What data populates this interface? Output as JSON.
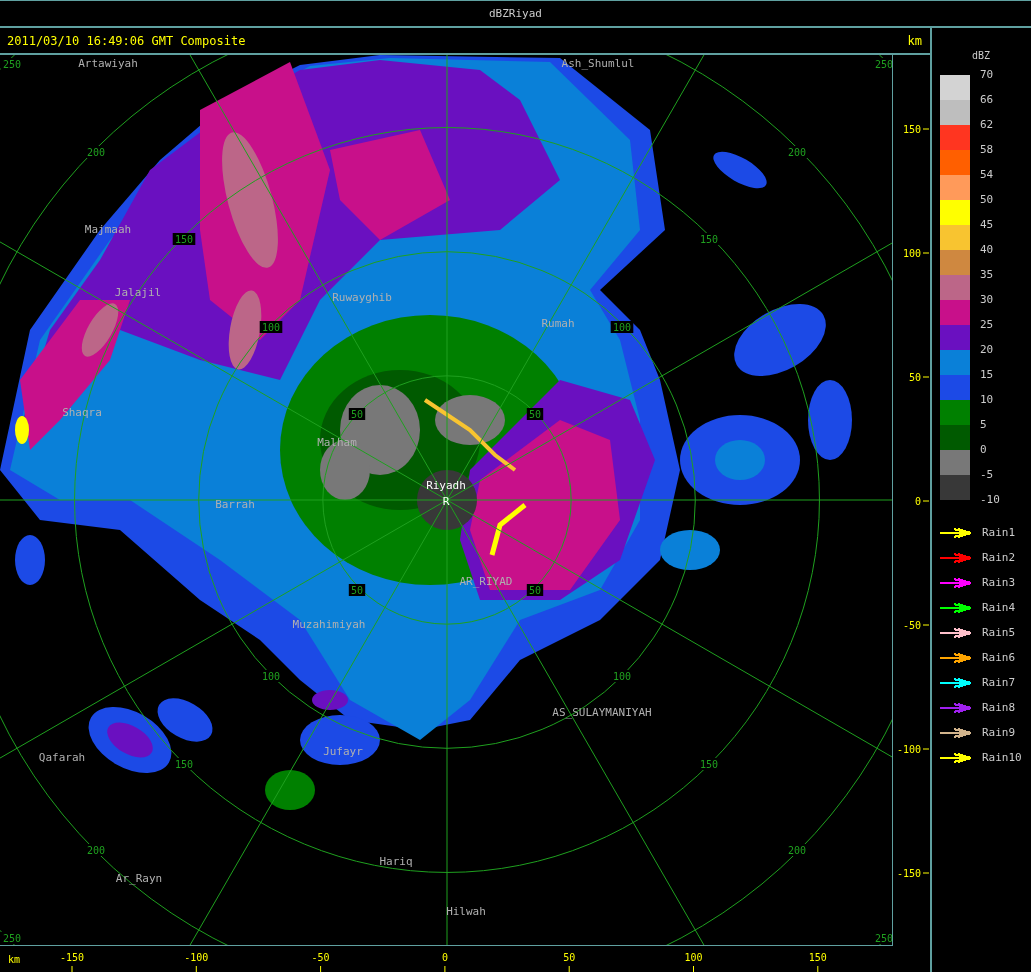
{
  "window": {
    "title": "dBZRiyad"
  },
  "header": {
    "timestamp": "2011/03/10 16:49:06 GMT Composite",
    "unit": "km"
  },
  "map": {
    "range_labels": [
      "250",
      "250",
      "250",
      "250",
      "200",
      "200",
      "200",
      "200",
      "150",
      "150",
      "150",
      "150",
      "100",
      "100",
      "100",
      "100",
      "50",
      "50",
      "50",
      "50"
    ],
    "place_labels": [
      "Artawiyah",
      "Ash_Shumlul",
      "Majmaah",
      "Jalajil",
      "Shaqra",
      "Ruwayghib",
      "Rumah",
      "Malham",
      "Riyadh",
      "R",
      "Barrah",
      "AR_RIYAD",
      "Muzahimiyah",
      "AS_SULAYMANIYAH",
      "Jufayr",
      "Qafarah",
      "Hariq",
      "Ar_Rayn",
      "Hilwah"
    ]
  },
  "y_axis": {
    "ticks": [
      "150",
      "100",
      "50",
      "0",
      "-50",
      "-100",
      "-150"
    ]
  },
  "x_axis": {
    "unit": "km",
    "ticks": [
      "-150",
      "-100",
      "-50",
      "0",
      "50",
      "100",
      "150"
    ]
  },
  "legend": {
    "title": "dBZ",
    "swatches": [
      {
        "color": "#d3d3d3"
      },
      {
        "color": "#bebebe"
      },
      {
        "color": "#ff3520"
      },
      {
        "color": "#ff5f00"
      },
      {
        "color": "#ff9a5a"
      },
      {
        "color": "#ffff00"
      },
      {
        "color": "#f8c430"
      },
      {
        "color": "#cf8840"
      },
      {
        "color": "#bc6688"
      },
      {
        "color": "#c8108a"
      },
      {
        "color": "#6a10c0"
      },
      {
        "color": "#0a80d8"
      },
      {
        "color": "#1c4ae6"
      },
      {
        "color": "#008000"
      },
      {
        "color": "#005a00"
      },
      {
        "color": "#787878"
      },
      {
        "color": "#383838"
      }
    ],
    "labels": [
      "70",
      "66",
      "62",
      "58",
      "54",
      "50",
      "45",
      "40",
      "35",
      "30",
      "25",
      "20",
      "15",
      "10",
      "5",
      "0",
      "-5",
      "-10"
    ]
  },
  "tracks": [
    {
      "label": "Rain1",
      "color": "#ffff00"
    },
    {
      "label": "Rain2",
      "color": "#ff0000"
    },
    {
      "label": "Rain3",
      "color": "#ff00ff"
    },
    {
      "label": "Rain4",
      "color": "#00ff00"
    },
    {
      "label": "Rain5",
      "color": "#ffc0cb"
    },
    {
      "label": "Rain6",
      "color": "#ffa500"
    },
    {
      "label": "Rain7",
      "color": "#00ffff"
    },
    {
      "label": "Rain8",
      "color": "#a020f0"
    },
    {
      "label": "Rain9",
      "color": "#d2b48c"
    },
    {
      "label": "Rain10",
      "color": "#ffff00"
    }
  ]
}
